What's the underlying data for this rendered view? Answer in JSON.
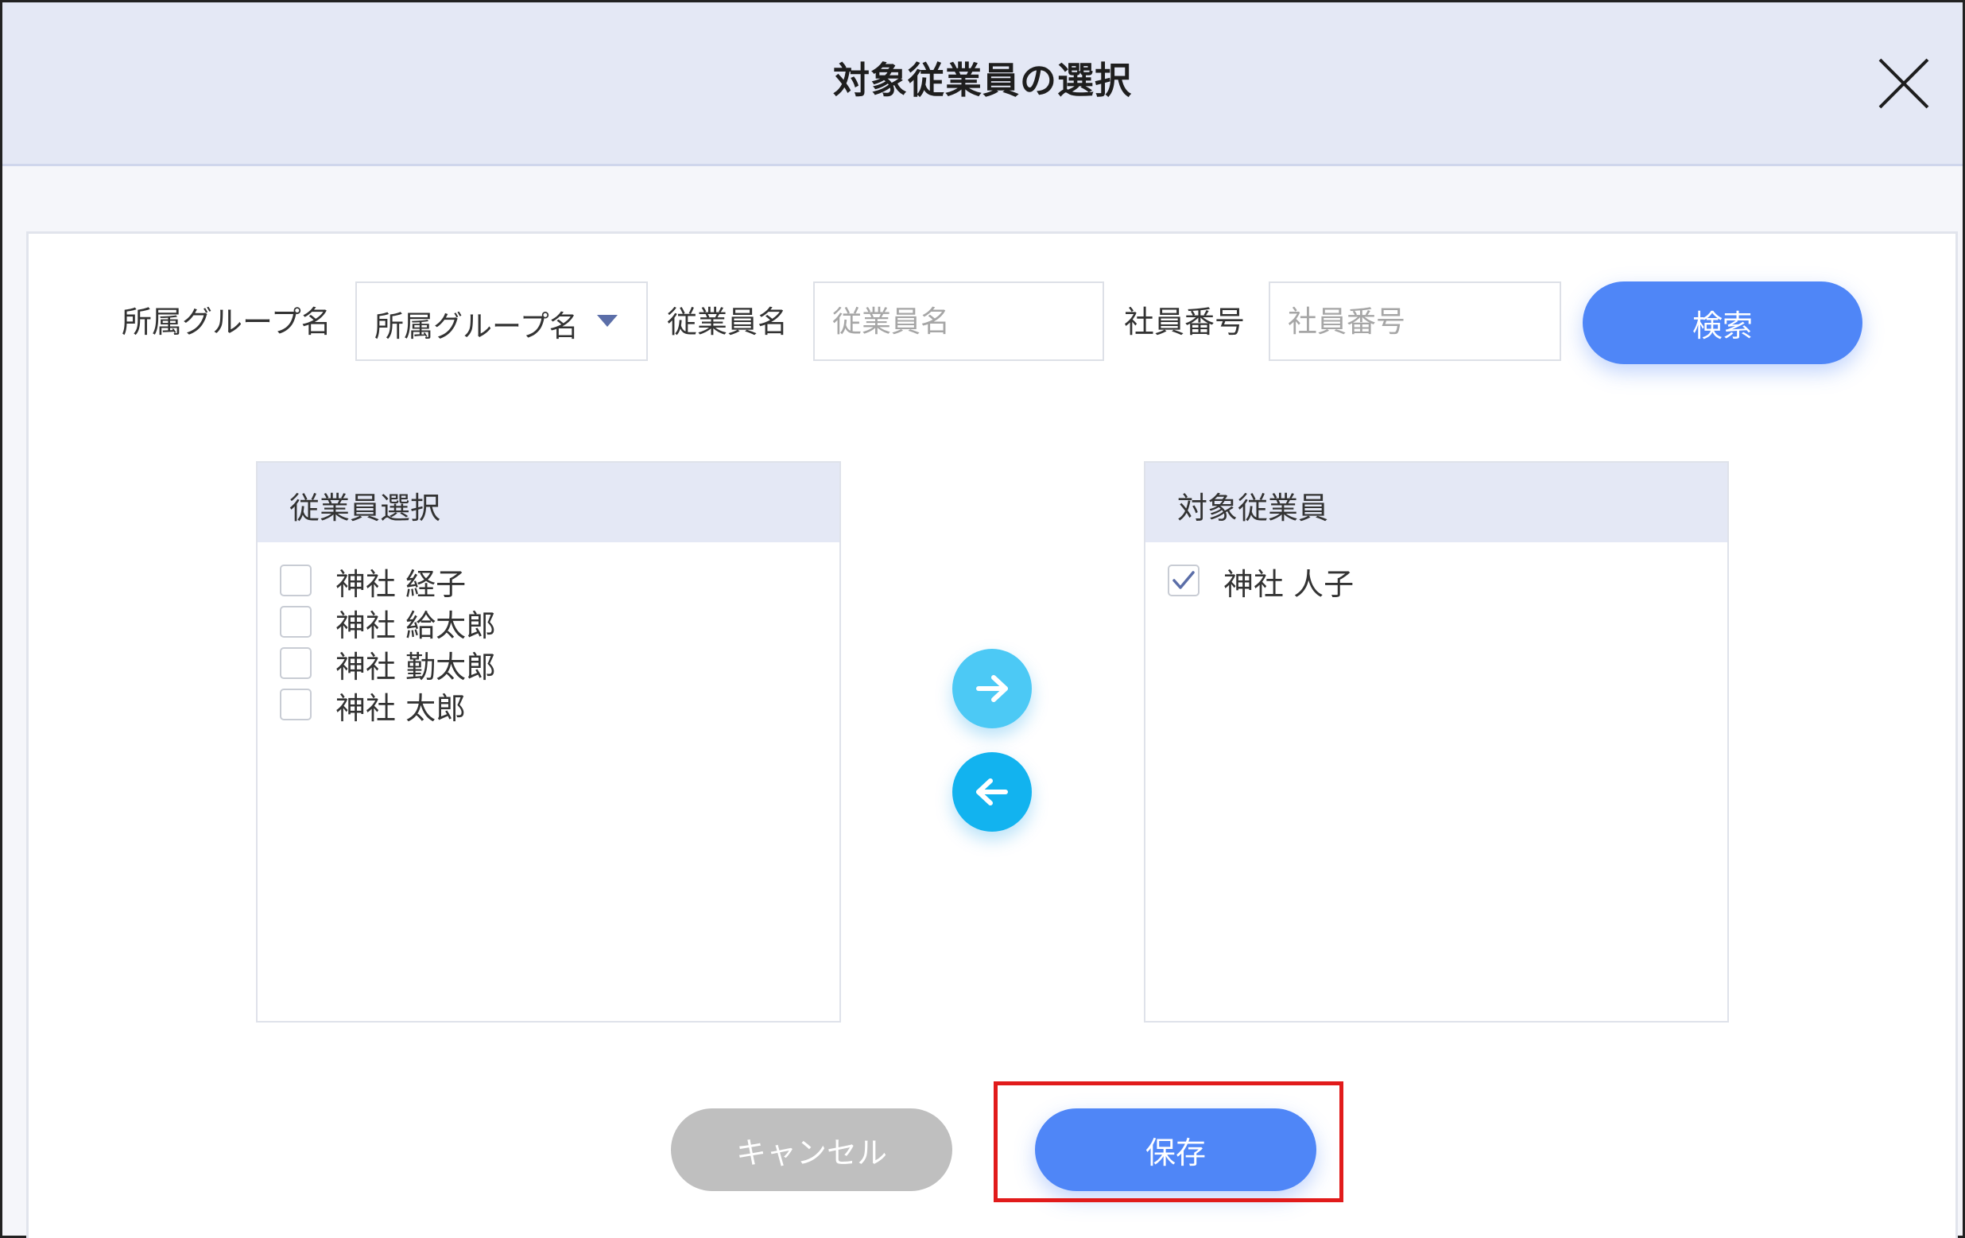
{
  "dialog": {
    "title": "対象従業員の選択"
  },
  "search": {
    "group_label": "所属グループ名",
    "group_select_value": "所属グループ名",
    "employee_name_label": "従業員名",
    "employee_name_placeholder": "従業員名",
    "employee_number_label": "社員番号",
    "employee_number_placeholder": "社員番号",
    "search_button": "検索"
  },
  "left_list": {
    "header": "従業員選択",
    "items": [
      {
        "name": "神社 経子",
        "checked": false
      },
      {
        "name": "神社 給太郎",
        "checked": false
      },
      {
        "name": "神社 勤太郎",
        "checked": false
      },
      {
        "name": "神社 太郎",
        "checked": false
      }
    ]
  },
  "right_list": {
    "header": "対象従業員",
    "items": [
      {
        "name": "神社 人子",
        "checked": true
      }
    ]
  },
  "transfer": {
    "add_icon": "arrow-right-icon",
    "remove_icon": "arrow-left-icon"
  },
  "footer": {
    "cancel_button": "キャンセル",
    "save_button": "保存"
  },
  "colors": {
    "primary": "#4f86f7",
    "transfer_add": "#4cc9f5",
    "transfer_remove": "#12b3ef",
    "highlight": "#e11b1b",
    "header_bg": "#e4e8f5"
  }
}
